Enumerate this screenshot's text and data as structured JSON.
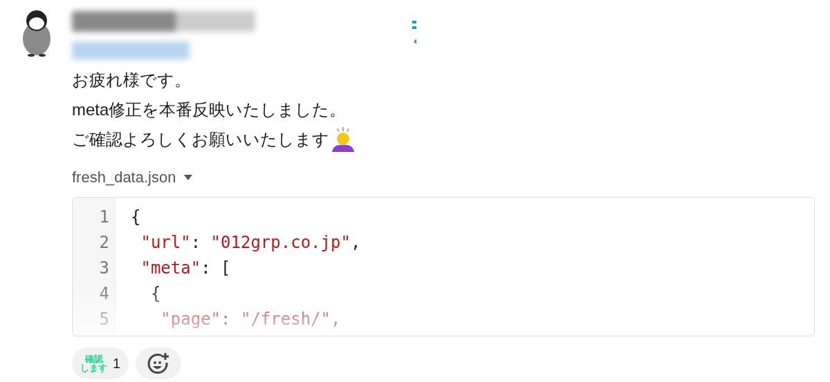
{
  "message": {
    "lines": [
      "お疲れ様です。",
      "meta修正を本番反映いたしました。",
      "ご確認よろしくお願いいたします"
    ],
    "attachment": {
      "filename": "fresh_data.json",
      "code_lines": [
        {
          "number": "1",
          "tokens": [
            {
              "kind": "punct",
              "text": "{"
            }
          ]
        },
        {
          "number": "2",
          "tokens": [
            {
              "kind": "key",
              "text": " \"url\""
            },
            {
              "kind": "punct",
              "text": ": "
            },
            {
              "kind": "string",
              "text": "\"012grp.co.jp\""
            },
            {
              "kind": "punct",
              "text": ","
            }
          ]
        },
        {
          "number": "3",
          "tokens": [
            {
              "kind": "key",
              "text": " \"meta\""
            },
            {
              "kind": "punct",
              "text": ": ["
            }
          ]
        },
        {
          "number": "4",
          "tokens": [
            {
              "kind": "punct",
              "text": "  {"
            }
          ]
        },
        {
          "number": "5",
          "tokens": [
            {
              "kind": "key",
              "text": "   \"page\""
            },
            {
              "kind": "punct",
              "text": ": "
            },
            {
              "kind": "string",
              "text": "\"/fresh/\""
            },
            {
              "kind": "punct",
              "text": ","
            }
          ]
        }
      ]
    }
  },
  "reactions": [
    {
      "kind": "emoji",
      "emoji_lines": [
        "確認",
        "します"
      ],
      "count": "1"
    },
    {
      "kind": "add"
    }
  ]
}
